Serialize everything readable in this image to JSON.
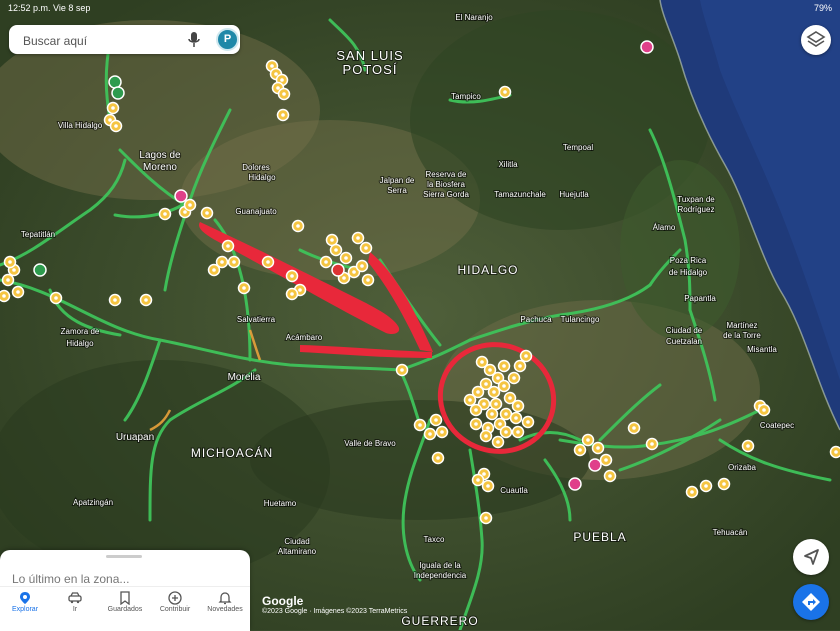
{
  "status_bar": {
    "left": "12:52 p.m.  Vie 8 sep",
    "right": "79%"
  },
  "search": {
    "placeholder": "Buscar aquí",
    "avatar_letter": "P"
  },
  "map_labels": {
    "states": [
      "SAN LUIS",
      "POTOSÍ",
      "HIDALGO",
      "MICHOACÁN",
      "PUEBLA",
      "GUERRERO"
    ],
    "cities": [
      "Lagos de",
      "Moreno",
      "Poza Rica",
      "de Hidalgo",
      "Morelia",
      "Uruapan",
      "Tehuacán",
      "Orizaba",
      "Coatepec",
      "Valle de Bravo",
      "Pachuca",
      "Tulancingo",
      "Ciudad de",
      "Cuetzalan",
      "Guanajuato",
      "Zamora de",
      "Hidalgo",
      "Apatzingán",
      "Taxco",
      "Iguala de la",
      "Independencia",
      "Acámbaro",
      "Dolores",
      "Hidalgo",
      "Tampico",
      "El Naranjo",
      "Martínez",
      "de la Torre",
      "Papantla",
      "Misantla",
      "Huetamo",
      "Ciudad",
      "Altamirano",
      "Cuautla",
      "Salvatierra",
      "Villa Hidalgo",
      "Tepatitlán",
      "Jalpan de",
      "Serra",
      "Xilitla",
      "Reserva de",
      "la Biosfera",
      "Sierra Gorda",
      "Tamazunchale",
      "Huejutla",
      "Tempoal",
      "Álamo",
      "Tuxpan de",
      "Rodríguez"
    ]
  },
  "sheet": {
    "title": "Lo último en la zona..."
  },
  "tabs": [
    {
      "label": "Explorar",
      "icon": "location-pin-icon",
      "active": true
    },
    {
      "label": "Ir",
      "icon": "car-icon",
      "active": false
    },
    {
      "label": "Guardados",
      "icon": "bookmark-icon",
      "active": false
    },
    {
      "label": "Contribuir",
      "icon": "plus-circle-icon",
      "active": false
    },
    {
      "label": "Novedades",
      "icon": "bell-icon",
      "active": false
    }
  ],
  "attribution": {
    "logo": "Google",
    "text": "©2023 Google · Imágenes ©2023 TerraMetrics"
  },
  "colors": {
    "accent": "#1a73e8",
    "annotation": "#e8283a",
    "pin": "#f5c542",
    "road": "#3fc35a",
    "ocean": "#1f3a7a"
  }
}
